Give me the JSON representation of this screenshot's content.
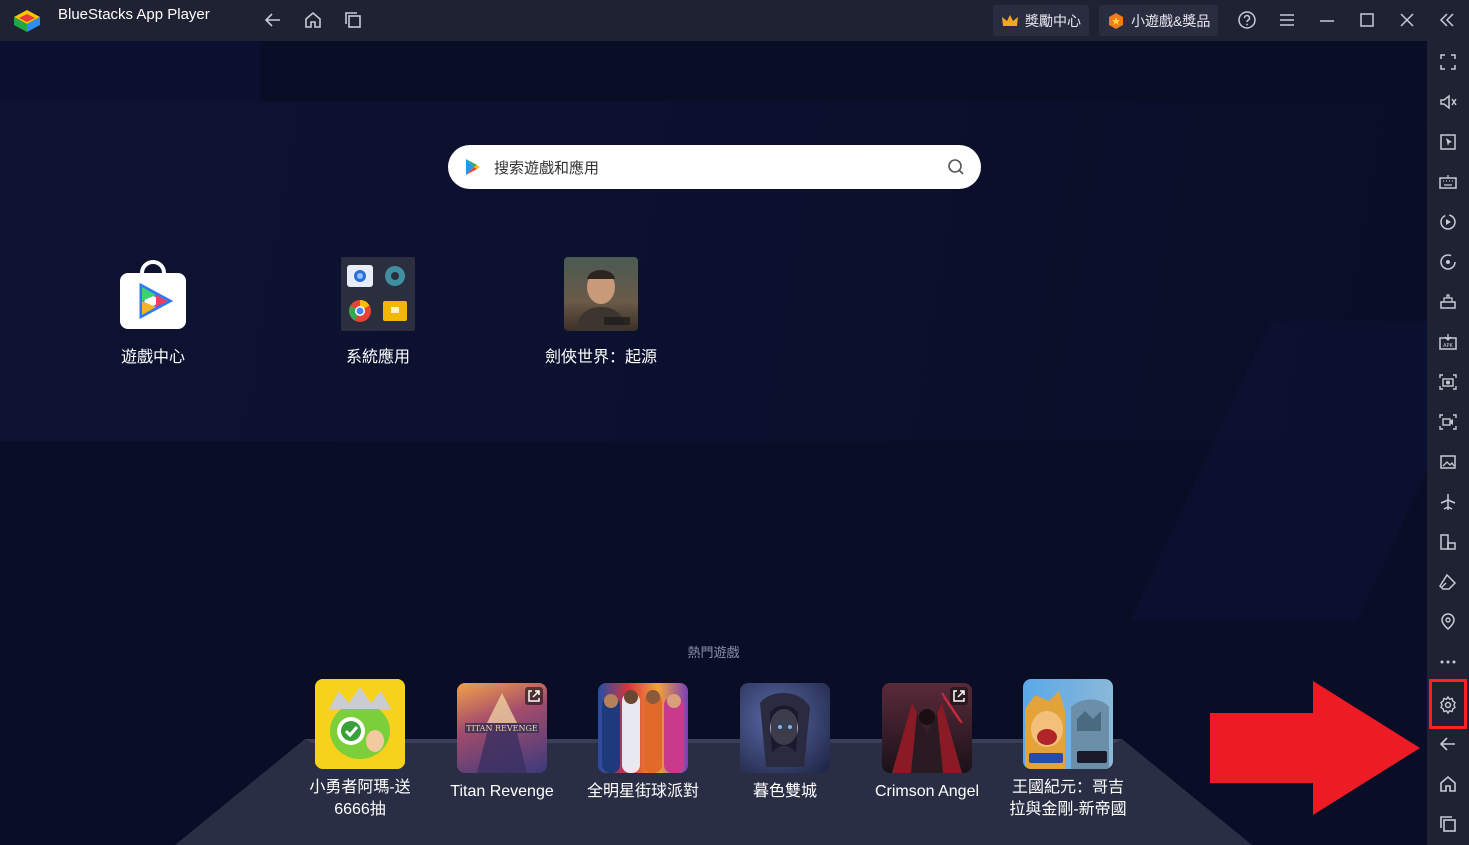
{
  "window": {
    "title": "BlueStacks App Player"
  },
  "titlebar": {
    "rewards_label": "獎勵中心",
    "minigames_label": "小遊戲&獎品"
  },
  "search": {
    "placeholder": "搜索遊戲和應用"
  },
  "apps": [
    {
      "label": "遊戲中心"
    },
    {
      "label": "系統應用"
    },
    {
      "label": "劍俠世界：起源"
    }
  ],
  "popular": {
    "section_label": "熱門遊戲",
    "games": [
      {
        "label_line1": "小勇者阿瑪-送",
        "label_line2": "6666抽"
      },
      {
        "label_line1": "Titan Revenge",
        "label_line2": ""
      },
      {
        "label_line1": "全明星街球派對",
        "label_line2": ""
      },
      {
        "label_line1": "暮色雙城",
        "label_line2": ""
      },
      {
        "label_line1": "Crimson Angel",
        "label_line2": ""
      },
      {
        "label_line1": "王國紀元：哥吉",
        "label_line2": "拉與金剛-新帝國"
      }
    ]
  },
  "colors": {
    "background": "#0a0d26",
    "titlebar": "#1f2232",
    "highlight": "#ff2020",
    "arrow": "#ed1c24"
  }
}
